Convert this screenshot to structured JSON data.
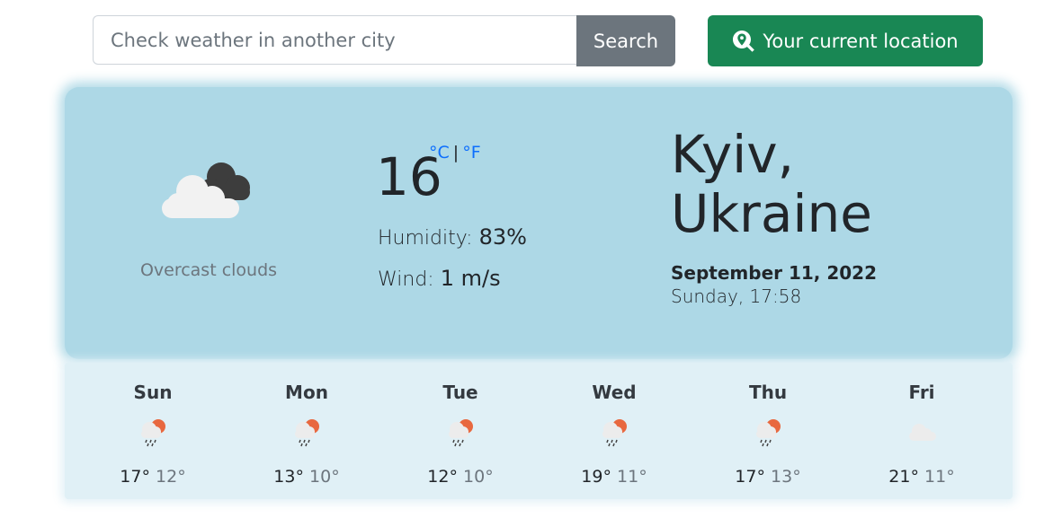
{
  "search": {
    "placeholder": "Check weather in another city",
    "button_label": "Search",
    "location_label": "Your current location"
  },
  "current": {
    "condition": "Overcast clouds",
    "condition_icon": "overcast-clouds-icon",
    "temperature": "16",
    "unit_c": "°C",
    "unit_sep": "|",
    "unit_f": "°F",
    "humidity_label": "Humidity:",
    "humidity_value": "83%",
    "wind_label": "Wind:",
    "wind_value": "1 m/s",
    "city": "Kyiv, Ukraine",
    "date": "September 11, 2022",
    "day_time": "Sunday, 17:58"
  },
  "forecast": [
    {
      "day": "Sun",
      "max": "17°",
      "min": "12°",
      "icon": "rain-sun-icon"
    },
    {
      "day": "Mon",
      "max": "13°",
      "min": "10°",
      "icon": "rain-sun-icon"
    },
    {
      "day": "Tue",
      "max": "12°",
      "min": "10°",
      "icon": "rain-sun-icon"
    },
    {
      "day": "Wed",
      "max": "19°",
      "min": "11°",
      "icon": "rain-sun-icon"
    },
    {
      "day": "Thu",
      "max": "17°",
      "min": "13°",
      "icon": "rain-sun-icon"
    },
    {
      "day": "Fri",
      "max": "21°",
      "min": "11°",
      "icon": "cloud-icon"
    }
  ],
  "colors": {
    "card": "#add8e6",
    "forecast_bg": "#e0f0f6",
    "search_btn": "#6c757d",
    "location_btn": "#198754",
    "unit_link": "#0d6efd"
  }
}
